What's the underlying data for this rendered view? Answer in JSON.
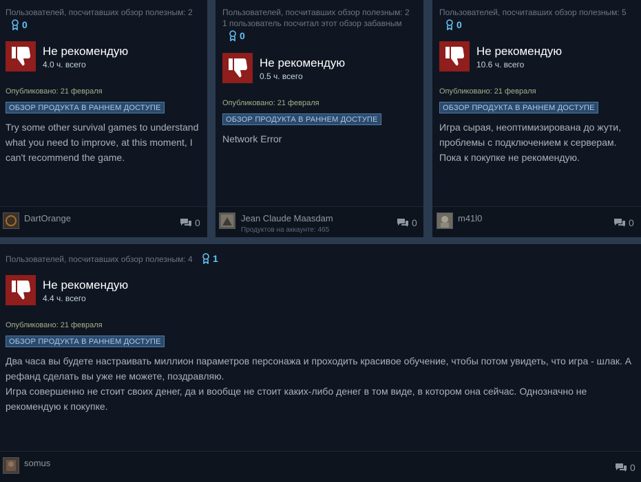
{
  "reviews": [
    {
      "helpful": "Пользователей, посчитавших обзор полезным: 2",
      "funny": "",
      "awards": "0",
      "verdict": "Не рекомендую",
      "hours": "4.0 ч. всего",
      "published": "Опубликовано: 21 февраля",
      "badge": "ОБЗОР ПРОДУКТА В РАННЕМ ДОСТУПЕ",
      "text": "Try some other survival games to understand what you need to improve, at this moment, I can't recommend the game.",
      "author": "DartOrange",
      "products": "",
      "comments": "0"
    },
    {
      "helpful": "Пользователей, посчитавших обзор полезным: 2",
      "funny": "1 пользователь посчитал этот обзор забавным",
      "awards": "0",
      "verdict": "Не рекомендую",
      "hours": "0.5 ч. всего",
      "published": "Опубликовано: 21 февраля",
      "badge": "ОБЗОР ПРОДУКТА В РАННЕМ ДОСТУПЕ",
      "text": "Network Error",
      "author": "Jean Claude Maasdam",
      "products": "Продуктов на аккаунте: 465",
      "comments": "0"
    },
    {
      "helpful": "Пользователей, посчитавших обзор полезным: 5",
      "funny": "",
      "awards": "0",
      "verdict": "Не рекомендую",
      "hours": "10.6 ч. всего",
      "published": "Опубликовано: 21 февраля",
      "badge": "ОБЗОР ПРОДУКТА В РАННЕМ ДОСТУПЕ",
      "text": "Игра сырая, неоптимизирована до жути, проблемы с подключением к серверам. Пока к покупке не рекомендую.",
      "author": "m41l0",
      "products": "",
      "comments": "0"
    },
    {
      "helpful": "Пользователей, посчитавших обзор полезным: 4",
      "funny": "",
      "awards": "1",
      "verdict": "Не рекомендую",
      "hours": "4.4 ч. всего",
      "published": "Опубликовано: 21 февраля",
      "badge": "ОБЗОР ПРОДУКТА В РАННЕМ ДОСТУПЕ",
      "text_line1": "Два часа вы будете настраивать миллион параметров персонажа и проходить красивое обучение, чтобы потом увидеть, что игра - шлак. А рефанд сделать вы уже не можете, поздравляю.",
      "text_line2": "Игра совершенно не стоит своих денег, да и вообще не стоит каких-либо денег в том виде, в котором она сейчас. Однозначно не рекомендую к покупке.",
      "author": "somus",
      "products": "",
      "comments": "0"
    }
  ],
  "colors": {
    "thumb_bg": "#8f1e1c",
    "badge_bg": "#2c4a6c",
    "accent": "#67c1f5"
  },
  "icons": {
    "thumb": "thumbs-down-icon",
    "award": "award-icon",
    "comment": "comment-icon"
  }
}
